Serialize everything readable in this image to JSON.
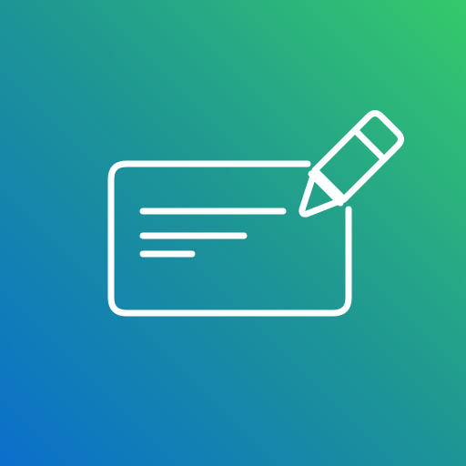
{
  "app_icon": {
    "icon_name": "check-edit-icon",
    "parts": [
      "card-icon",
      "pencil-icon"
    ],
    "colors": {
      "gradient_bottom_left": "#0a6fcc",
      "gradient_middle": "#1d9496",
      "gradient_top_right": "#35c96a",
      "stroke": "#ffffff"
    }
  }
}
